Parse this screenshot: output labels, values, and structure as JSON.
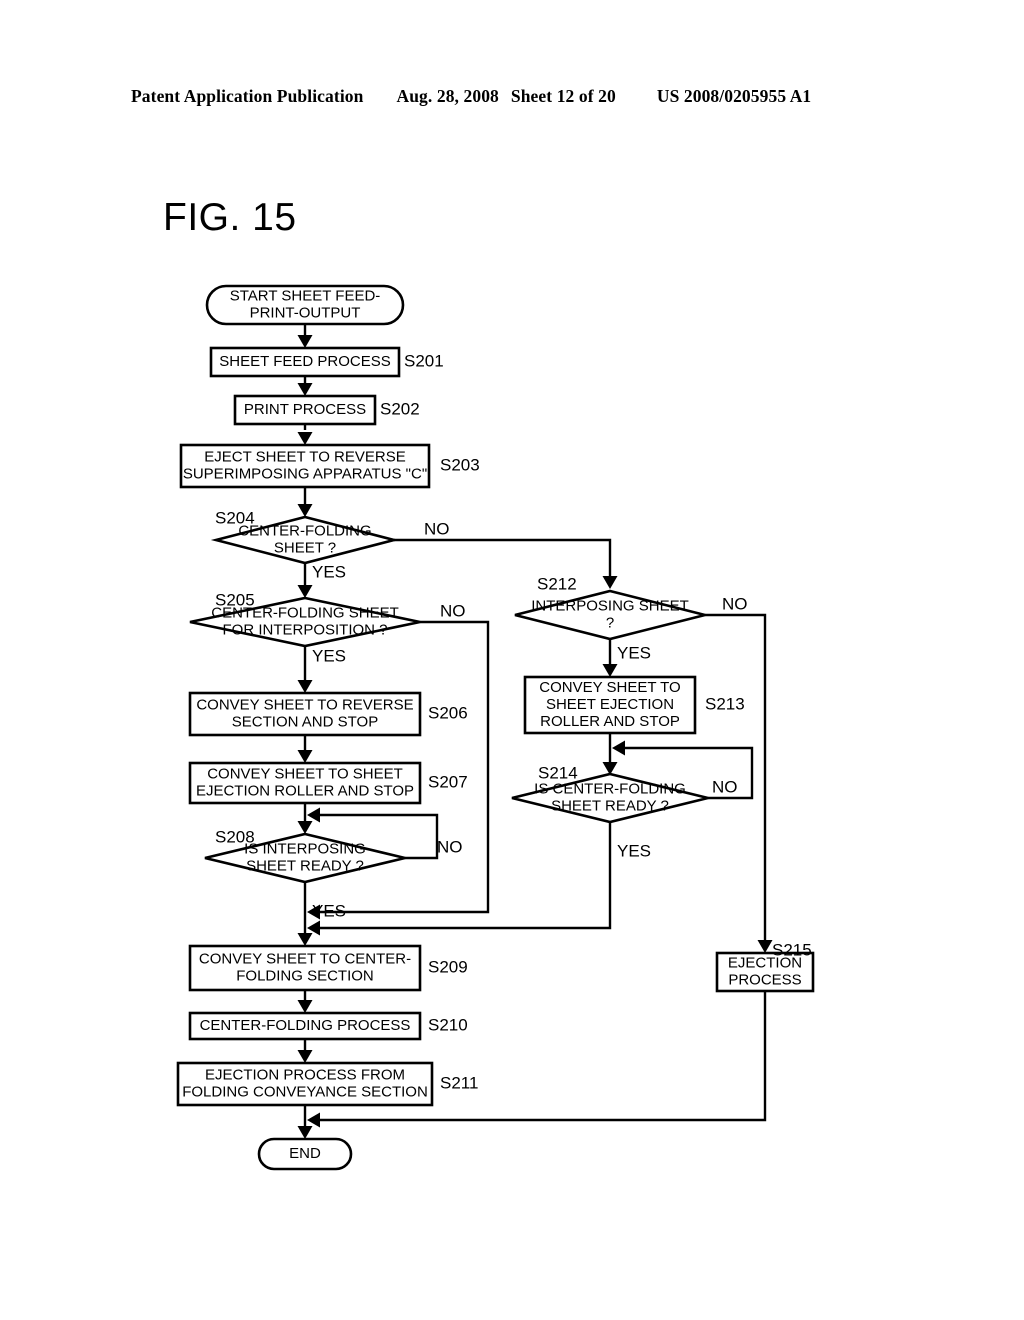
{
  "header": {
    "publication": "Patent Application Publication",
    "date": "Aug. 28, 2008",
    "sheet": "Sheet 12 of 20",
    "patent_number": "US 2008/0205955 A1"
  },
  "figure": {
    "title": "FIG. 15"
  },
  "flowchart": {
    "start": {
      "id": "start",
      "type": "terminal",
      "lines": [
        "START SHEET FEED-",
        "PRINT-OUTPUT"
      ]
    },
    "end": {
      "id": "end",
      "type": "terminal",
      "lines": [
        "END"
      ]
    },
    "nodes": [
      {
        "key": "s201",
        "type": "process",
        "step": "S201",
        "lines": [
          "SHEET FEED PROCESS"
        ]
      },
      {
        "key": "s202",
        "type": "process",
        "step": "S202",
        "lines": [
          "PRINT PROCESS"
        ]
      },
      {
        "key": "s203",
        "type": "process",
        "step": "S203",
        "lines": [
          "EJECT SHEET TO REVERSE",
          "SUPERIMPOSING APPARATUS \"C\""
        ]
      },
      {
        "key": "s204",
        "type": "decision",
        "step": "S204",
        "lines": [
          "CENTER-FOLDING",
          "SHEET ?"
        ],
        "yes": "YES",
        "no": "NO"
      },
      {
        "key": "s205",
        "type": "decision",
        "step": "S205",
        "lines": [
          "CENTER-FOLDING SHEET",
          "FOR INTERPOSITION ?"
        ],
        "yes": "YES",
        "no": "NO"
      },
      {
        "key": "s206",
        "type": "process",
        "step": "S206",
        "lines": [
          "CONVEY SHEET TO REVERSE",
          "SECTION AND STOP"
        ]
      },
      {
        "key": "s207",
        "type": "process",
        "step": "S207",
        "lines": [
          "CONVEY SHEET TO SHEET",
          "EJECTION ROLLER AND STOP"
        ]
      },
      {
        "key": "s208",
        "type": "decision",
        "step": "S208",
        "lines": [
          "IS INTERPOSING",
          "SHEET READY ?"
        ],
        "yes": "YES",
        "no": "NO"
      },
      {
        "key": "s209",
        "type": "process",
        "step": "S209",
        "lines": [
          "CONVEY SHEET TO CENTER-",
          "FOLDING SECTION"
        ]
      },
      {
        "key": "s210",
        "type": "process",
        "step": "S210",
        "lines": [
          "CENTER-FOLDING PROCESS"
        ]
      },
      {
        "key": "s211",
        "type": "process",
        "step": "S211",
        "lines": [
          "EJECTION PROCESS FROM",
          "FOLDING CONVEYANCE SECTION"
        ]
      },
      {
        "key": "s212",
        "type": "decision",
        "step": "S212",
        "lines": [
          "INTERPOSING SHEET",
          "?"
        ],
        "yes": "YES",
        "no": "NO"
      },
      {
        "key": "s213",
        "type": "process",
        "step": "S213",
        "lines": [
          "CONVEY SHEET TO",
          "SHEET EJECTION",
          "ROLLER AND STOP"
        ]
      },
      {
        "key": "s214",
        "type": "decision",
        "step": "S214",
        "lines": [
          "IS CENTER-FOLDING",
          "SHEET READY ?"
        ],
        "yes": "YES",
        "no": "NO"
      },
      {
        "key": "s215",
        "type": "process",
        "step": "S215",
        "lines": [
          "EJECTION",
          "PROCESS"
        ]
      }
    ]
  },
  "colors": {
    "ink": "#000000",
    "paper": "#ffffff"
  }
}
